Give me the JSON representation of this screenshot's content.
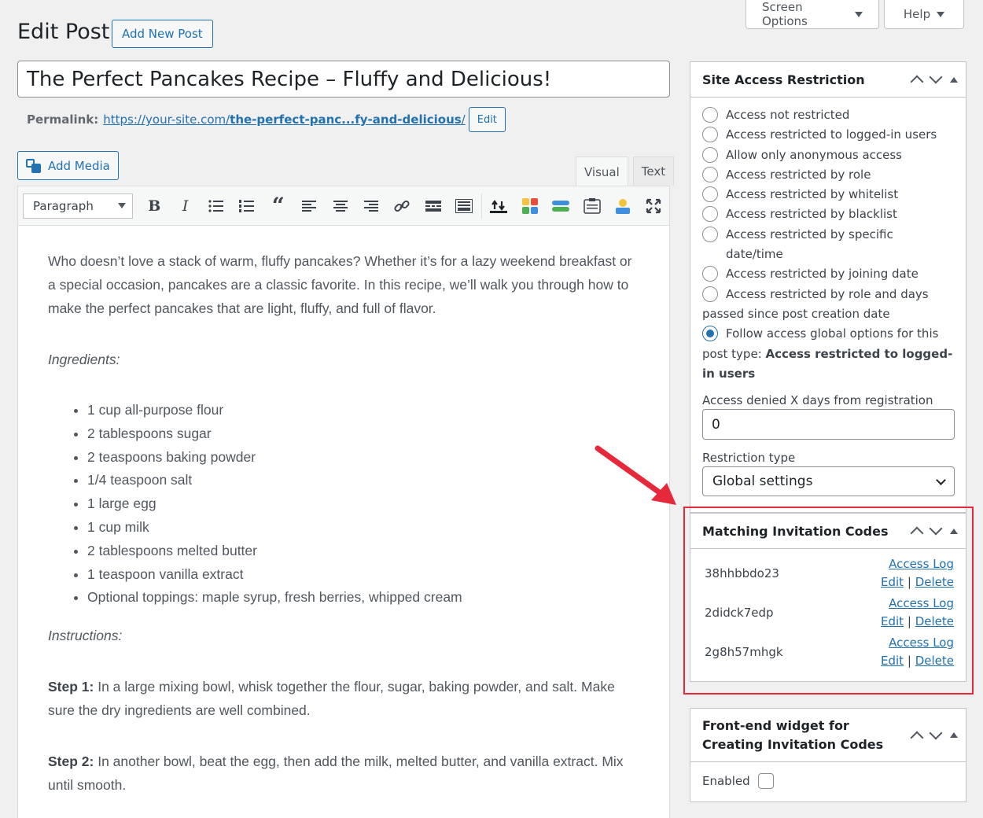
{
  "top": {
    "screen_options": "Screen Options",
    "help": "Help"
  },
  "header": {
    "title": "Edit Post",
    "add_new": "Add New Post"
  },
  "post": {
    "title": "The Perfect Pancakes Recipe – Fluffy and Delicious!",
    "permalink_label": "Permalink:",
    "permalink_prefix": "https://your-site.com/",
    "permalink_slug": "the-perfect-panc...fy-and-delicious",
    "permalink_suffix": "/",
    "permalink_edit": "Edit"
  },
  "editor": {
    "add_media": "Add Media",
    "tab_visual": "Visual",
    "tab_text": "Text",
    "format": "Paragraph",
    "intro": "Who doesn’t love a stack of warm, fluffy pancakes? Whether it’s for a lazy weekend breakfast or a special occasion, pancakes are a classic favorite. In this recipe, we’ll walk you through how to make the perfect pancakes that are light, fluffy, and full of flavor.",
    "ingredients_heading": "Ingredients:",
    "ingredients": [
      "1 cup all-purpose flour",
      "2 tablespoons sugar",
      "2 teaspoons baking powder",
      "1/4 teaspoon salt",
      "1 large egg",
      "1 cup milk",
      "2 tablespoons melted butter",
      "1 teaspoon vanilla extract",
      "Optional toppings: maple syrup, fresh berries, whipped cream"
    ],
    "instructions_heading": "Instructions:",
    "step1_label": "Step 1:",
    "step1_text": " In a large mixing bowl, whisk together the flour, sugar, baking powder, and salt. Make sure the dry ingredients are well combined.",
    "step2_label": "Step 2:",
    "step2_text": " In another bowl, beat the egg, then add the milk, melted butter, and vanilla extract. Mix until smooth."
  },
  "site_access": {
    "title": "Site Access Restriction",
    "options": [
      "Access not restricted",
      "Access restricted to logged-in users",
      "Allow only anonymous access",
      "Access restricted by role",
      "Access restricted by whitelist",
      "Access restricted by blacklist",
      "Access restricted by specific date/time",
      "Access restricted by joining date",
      "Access restricted by role and days"
    ],
    "option_last_wrap": "passed since post creation date",
    "global_option_a": "Follow access global options for this",
    "global_option_b": "post type: ",
    "global_option_value": "Access restricted to logged-in users",
    "days_label": "Access denied X days from registration",
    "days_value": "0",
    "restriction_label": "Restriction type",
    "restriction_value": "Global settings"
  },
  "invitations": {
    "title": "Matching Invitation Codes",
    "access_log": "Access Log",
    "edit": "Edit",
    "sep": "|",
    "delete": "Delete",
    "codes": [
      "38hhbbdo23",
      "2didck7edp",
      "2g8h57mhgk"
    ]
  },
  "widget": {
    "title_a": "Front-end widget for",
    "title_b": "Creating Invitation Codes",
    "enabled": "Enabled"
  },
  "colors": {
    "accent": "#2271b1",
    "highlight": "#e5293b",
    "arrow": "#e5293b"
  }
}
